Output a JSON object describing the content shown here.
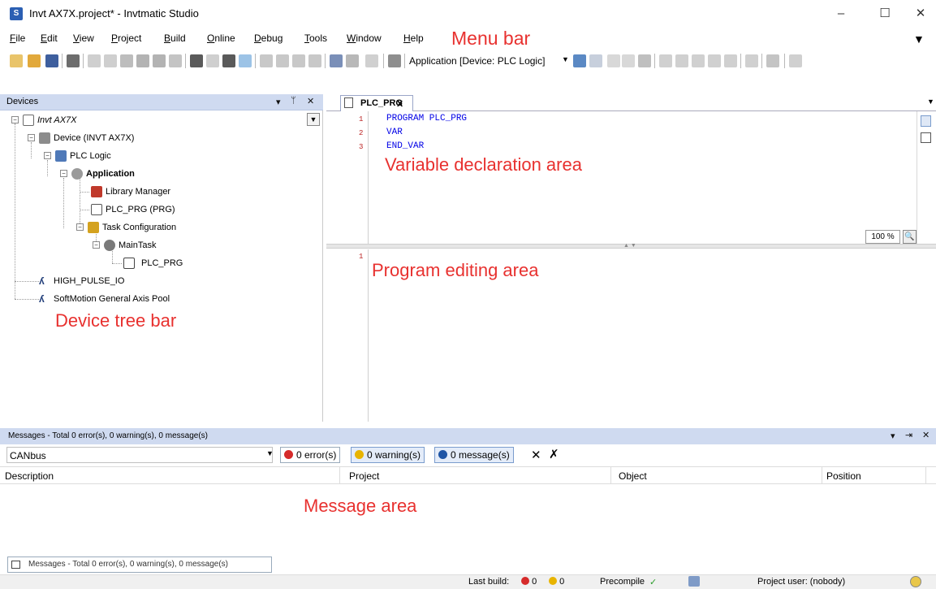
{
  "window": {
    "title": "Invt AX7X.project* - Invtmatic Studio",
    "app_icon_letter": "S",
    "minimize": "–",
    "maximize": "☐",
    "close": "✕"
  },
  "menu": {
    "items": [
      "File",
      "Edit",
      "View",
      "Project",
      "Build",
      "Online",
      "Debug",
      "Tools",
      "Window",
      "Help"
    ],
    "annotation": "Menu bar",
    "overflow": "▼"
  },
  "toolbar": {
    "application_selector": "Application [Device: PLC Logic]"
  },
  "devices": {
    "title": "Devices",
    "pin": "▾ ᛘ ✕",
    "tree": [
      {
        "label": "Invt AX7X",
        "italic": true
      },
      {
        "label": "Device (INVT AX7X)"
      },
      {
        "label": "PLC Logic"
      },
      {
        "label": "Application",
        "bold": true
      },
      {
        "label": "Library Manager"
      },
      {
        "label": "PLC_PRG (PRG)"
      },
      {
        "label": "Task Configuration"
      },
      {
        "label": "MainTask"
      },
      {
        "label": "PLC_PRG"
      },
      {
        "label": "HIGH_PULSE_IO"
      },
      {
        "label": "SoftMotion General Axis Pool"
      }
    ],
    "annotation": "Device tree bar"
  },
  "editor": {
    "tab_label": "PLC_PRG",
    "tab_close": "x",
    "declaration": {
      "line_numbers": [
        "1",
        "2",
        "3"
      ],
      "lines": [
        "PROGRAM PLC_PRG",
        "VAR",
        "END_VAR"
      ],
      "annotation": "Variable declaration area"
    },
    "zoom": "100 %",
    "body": {
      "line_numbers": [
        "1"
      ],
      "annotation": "Program editing area"
    }
  },
  "messages": {
    "title": "Messages - Total 0 error(s), 0 warning(s), 0 message(s)",
    "source": "CANbus",
    "filters": {
      "errors": "0 error(s)",
      "warnings": "0 warning(s)",
      "messages": "0 message(s)"
    },
    "columns": [
      "Description",
      "Project",
      "Object",
      "Position"
    ],
    "annotation": "Message area",
    "bottom_tab": "Messages - Total 0 error(s), 0 warning(s), 0 message(s)"
  },
  "status": {
    "last_build_label": "Last build:",
    "errors": "0",
    "warnings": "0",
    "precompile": "Precompile",
    "precompile_mark": "✓",
    "project_user": "Project user: (nobody)"
  },
  "colors": {
    "annotation": "#e8312f",
    "keyword": "#0000e6",
    "pane_header": "#cfdaf0",
    "error": "#d62b2b",
    "warning": "#e8b400",
    "info": "#1f55a5"
  }
}
